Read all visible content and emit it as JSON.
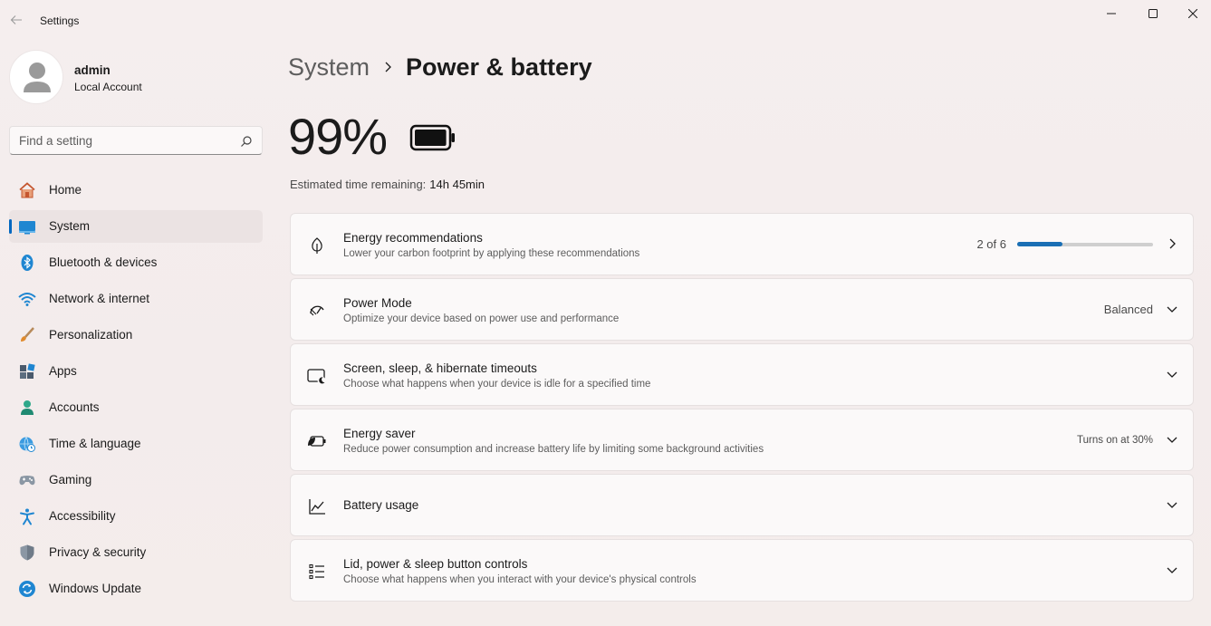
{
  "window": {
    "title": "Settings"
  },
  "profile": {
    "name": "admin",
    "account_type": "Local Account"
  },
  "search": {
    "placeholder": "Find a setting"
  },
  "sidebar": {
    "items": [
      {
        "label": "Home",
        "icon": "home-icon"
      },
      {
        "label": "System",
        "icon": "system-icon",
        "active": true
      },
      {
        "label": "Bluetooth & devices",
        "icon": "bluetooth-icon"
      },
      {
        "label": "Network & internet",
        "icon": "wifi-icon"
      },
      {
        "label": "Personalization",
        "icon": "brush-icon"
      },
      {
        "label": "Apps",
        "icon": "apps-icon"
      },
      {
        "label": "Accounts",
        "icon": "accounts-icon"
      },
      {
        "label": "Time & language",
        "icon": "globe-clock-icon"
      },
      {
        "label": "Gaming",
        "icon": "gamepad-icon"
      },
      {
        "label": "Accessibility",
        "icon": "accessibility-icon"
      },
      {
        "label": "Privacy & security",
        "icon": "shield-icon"
      },
      {
        "label": "Windows Update",
        "icon": "update-icon"
      }
    ]
  },
  "breadcrumb": {
    "parent": "System",
    "current": "Power & battery"
  },
  "battery": {
    "percent_text": "99%",
    "level": 0.99,
    "estimate_label": "Estimated time remaining:",
    "estimate_value": "14h 45min"
  },
  "cards": [
    {
      "title": "Energy recommendations",
      "desc": "Lower your carbon footprint by applying these recommendations",
      "icon": "leaf-icon",
      "progress_text": "2 of 6",
      "progress": 0.333,
      "chevron": "chevron-right-icon"
    },
    {
      "title": "Power Mode",
      "desc": "Optimize your device based on power use and performance",
      "icon": "power-mode-icon",
      "value": "Balanced",
      "chevron": "chevron-down-icon"
    },
    {
      "title": "Screen, sleep, & hibernate timeouts",
      "desc": "Choose what happens when your device is idle for a specified time",
      "icon": "screen-sleep-icon",
      "chevron": "chevron-down-icon"
    },
    {
      "title": "Energy saver",
      "desc": "Reduce power consumption and increase battery life by limiting some background activities",
      "icon": "energy-saver-icon",
      "value": "Turns on at 30%",
      "chevron": "chevron-down-icon"
    },
    {
      "title": "Battery usage",
      "icon": "chart-icon",
      "chevron": "chevron-down-icon"
    },
    {
      "title": "Lid, power & sleep button controls",
      "desc": "Choose what happens when you interact with your device's physical controls",
      "icon": "list-icon",
      "chevron": "chevron-down-icon"
    }
  ],
  "colors": {
    "accent": "#0067c0",
    "progress": "#1a6fb5"
  }
}
